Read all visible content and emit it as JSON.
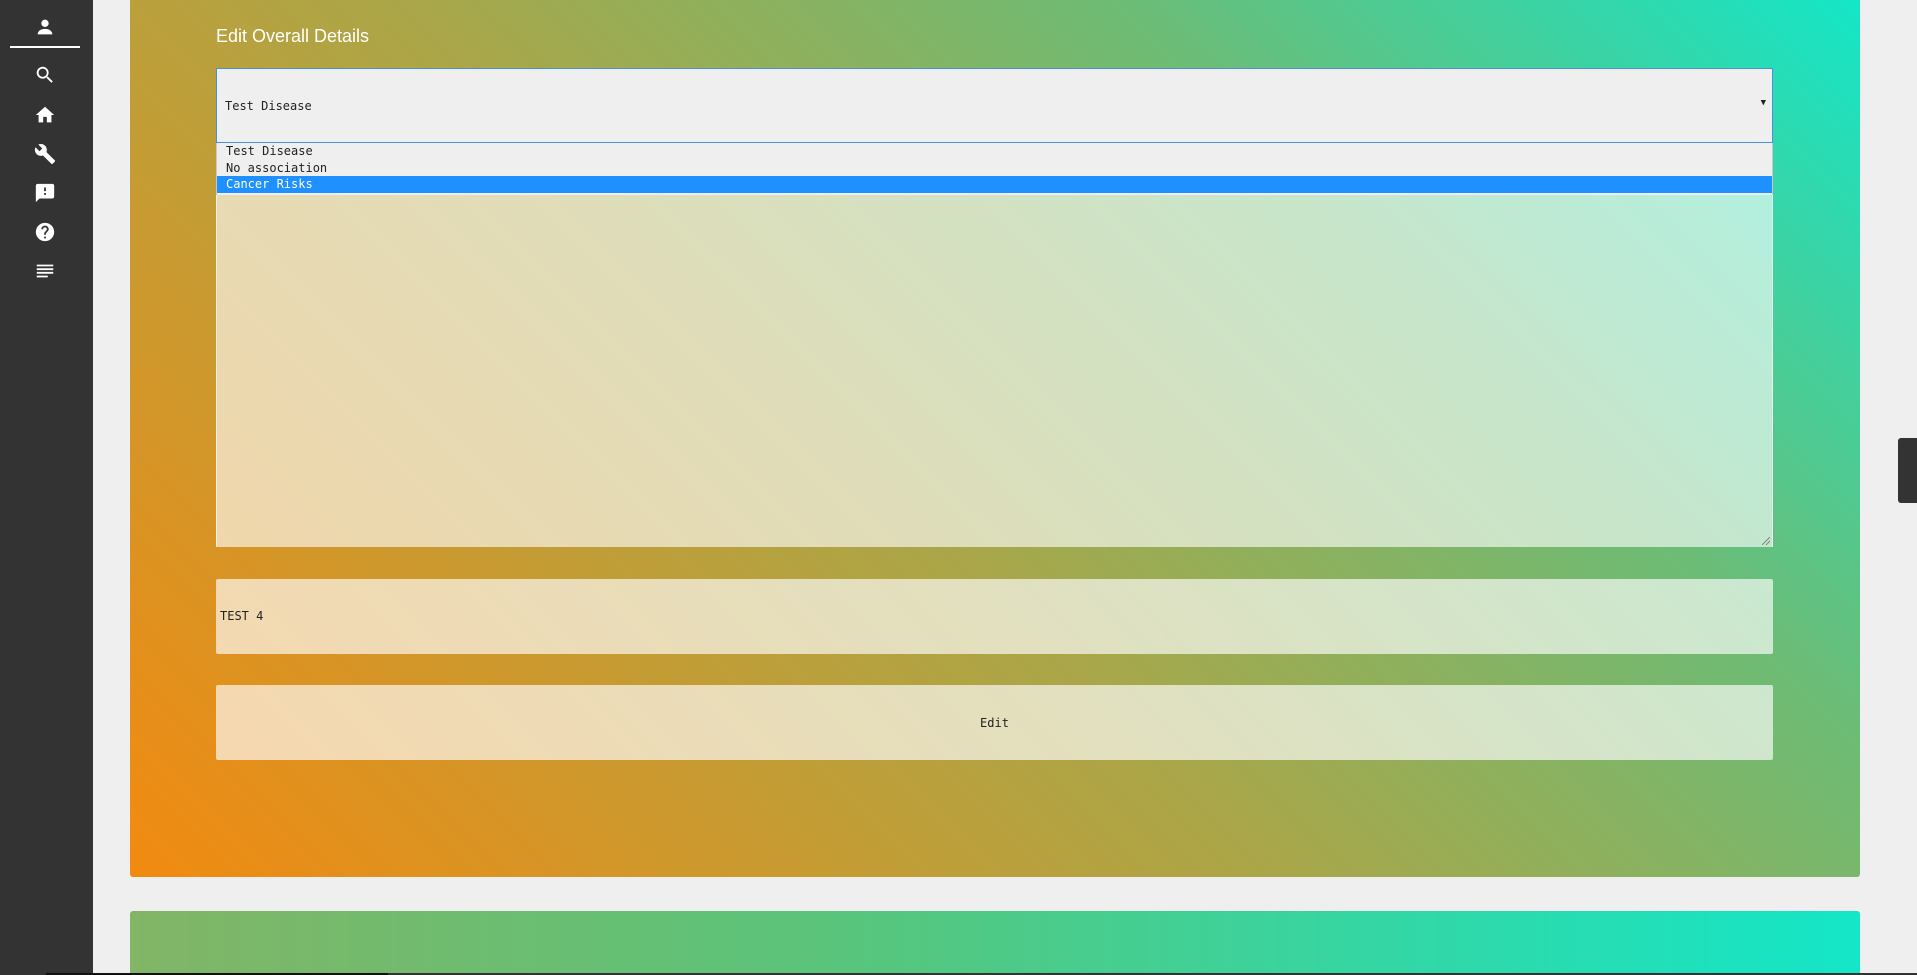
{
  "sidebar": {
    "items": [
      {
        "icon": "account-icon"
      },
      {
        "icon": "search-icon"
      },
      {
        "icon": "home-icon"
      },
      {
        "icon": "wrench-icon"
      },
      {
        "icon": "feedback-icon"
      },
      {
        "icon": "help-icon"
      },
      {
        "icon": "notes-icon"
      }
    ]
  },
  "panel": {
    "title": "Edit Overall Details"
  },
  "select": {
    "value": "Test Disease",
    "arrow": "▼",
    "options": [
      "Test Disease",
      "No association",
      "Cancer Risks"
    ],
    "highlighted_option": "Cancer Risks"
  },
  "text_input": {
    "value": "TEST 4"
  },
  "edit_button": {
    "label": "Edit"
  },
  "colors": {
    "sidebar": "#333333",
    "highlight": "#1e90ff",
    "gradient_start": "#14e6c8",
    "gradient_end": "#f28a10"
  }
}
